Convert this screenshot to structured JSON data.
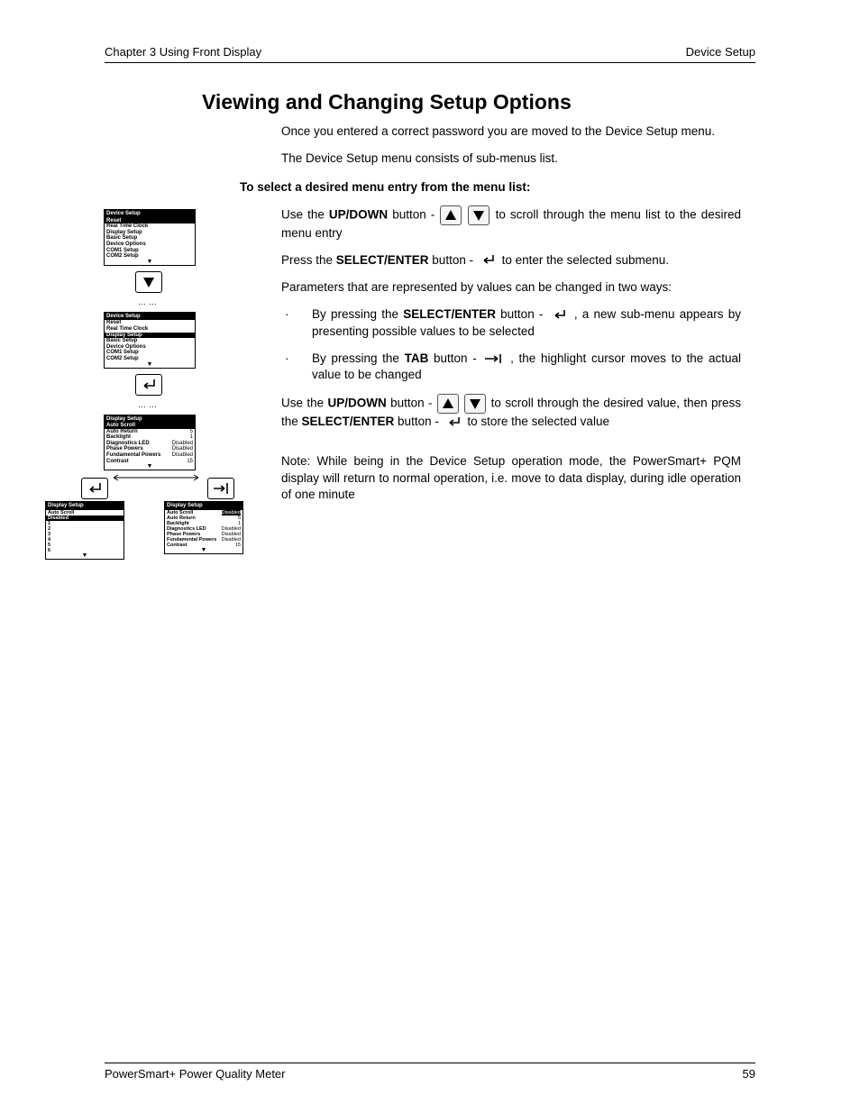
{
  "header": {
    "left": "Chapter 3   Using Front Display",
    "right": "Device Setup"
  },
  "title": "Viewing and Changing Setup Options",
  "p1": "Once you entered a correct password you are moved to the Device Setup menu.",
  "p2": "The Device Setup menu consists of sub-menus list.",
  "subhead": "To select a desired menu entry from the menu list:",
  "p3a": "Use the ",
  "p3b": "UP/DOWN",
  "p3c": " button - ",
  "p3d": " to scroll through the menu list to the desired menu entry",
  "p4a": "Press the ",
  "p4b": "SELECT/ENTER",
  "p4c": " button - ",
  "p4d": " to enter the selected submenu.",
  "p5": "Parameters that are represented by values can be changed in two ways:",
  "b1a": "By pressing the ",
  "b1b": "SELECT/ENTER",
  "b1c": " button - ",
  "b1d": " , a new sub-menu appears by presenting possible values to be selected",
  "b2a": " By pressing the ",
  "b2b": "TAB",
  "b2c": " button - ",
  "b2d": " , the highlight cursor moves to the actual value to be changed",
  "p6a": "Use the ",
  "p6b": "UP/DOWN",
  "p6c": " button - ",
  "p6d": " to scroll through the desired value, then press the ",
  "p6e": "SELECT/ENTER",
  "p6f": " button - ",
  "p6g": "  to store the selected value",
  "note": "Note: While being in the Device Setup operation mode, the PowerSmart+ PQM display will return to normal operation, i.e. move to data display, during idle operation of one minute",
  "footer": {
    "left": "PowerSmart+ Power Quality Meter",
    "right": "59"
  },
  "mock": {
    "panel1": {
      "title": "Device Setup",
      "rows": [
        "Reset",
        "Real Time Clock",
        "Display Setup",
        "Basic Setup",
        "Device Options",
        "COM1 Setup",
        "COM2 Setup"
      ],
      "hl": 0
    },
    "panel2": {
      "title": "Device Setup",
      "rows": [
        "Reset",
        "Real Time Clock",
        "Display Setup",
        "Basic Setup",
        "Device Options",
        "COM1 Setup",
        "COM2 Setup"
      ],
      "hl": 2
    },
    "panel3": {
      "title": "Display Setup",
      "rows": [
        [
          "Auto Scroll",
          ""
        ],
        [
          "Auto Return",
          "5"
        ],
        [
          "Backlight",
          "1"
        ],
        [
          "Diagnostics LED",
          "Disabled"
        ],
        [
          "Phase Powers",
          "Disabled"
        ],
        [
          "Fundamental Powers",
          "Disabled"
        ],
        [
          "Contrast",
          "15"
        ]
      ],
      "hl": 0
    },
    "panel4": {
      "title": "Display Setup",
      "opt_label": "Auto Scroll",
      "opt_val": "Disabled",
      "rows": [
        "1",
        "2",
        "3",
        "4",
        "5",
        "6"
      ]
    },
    "panel5": {
      "title": "Display Setup",
      "rows": [
        [
          "Auto Scroll",
          "Disabled"
        ],
        [
          "Auto Return",
          "5"
        ],
        [
          "Backlight",
          "1"
        ],
        [
          "Diagnostics LED",
          "Disabled"
        ],
        [
          "Phase Powers",
          "Disabled"
        ],
        [
          "Fundamental Powers",
          "Disabled"
        ],
        [
          "Contrast",
          "15"
        ]
      ],
      "hl_val": 0
    }
  }
}
